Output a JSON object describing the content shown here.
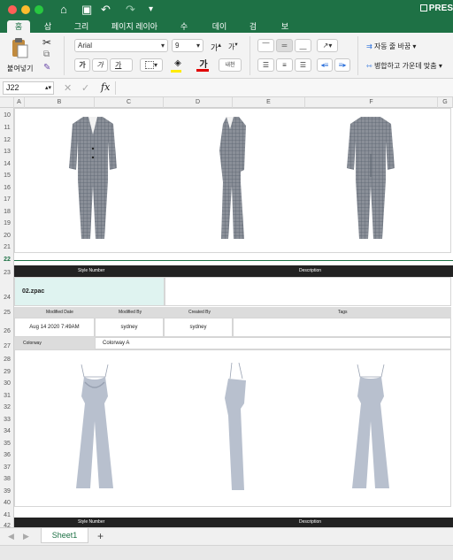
{
  "app": {
    "title_partial": "PRES"
  },
  "quick_access": {
    "home": "⌂",
    "save": "▣",
    "undo": "↶",
    "redo": "↷",
    "more": "▾"
  },
  "tabs": [
    "홈",
    "삽입",
    "그리기",
    "페이지 레이아웃",
    "수식",
    "데이터",
    "검토",
    "보기"
  ],
  "ribbon": {
    "paste": "붙여넣기",
    "font_name": "Arial",
    "font_size": "9",
    "grow": "가",
    "shrink": "가",
    "bold": "가",
    "italic": "가",
    "underline": "가",
    "font_color_glyph": "가",
    "phonetic": "내천",
    "wrap_text": "자동 줄 바꿈",
    "merge_center": "병합하고 가운데 맞춤"
  },
  "formula_bar": {
    "name_box": "J22",
    "cancel": "✕",
    "enter": "✓",
    "fx": "fx",
    "value": ""
  },
  "columns": [
    "A",
    "B",
    "C",
    "D",
    "E",
    "F",
    "G"
  ],
  "rows": [
    "10",
    "11",
    "12",
    "13",
    "14",
    "15",
    "16",
    "17",
    "18",
    "19",
    "20",
    "21",
    "22",
    "23",
    "24",
    "25",
    "26",
    "27",
    "28",
    "29",
    "30",
    "31",
    "32",
    "33",
    "34",
    "35",
    "36",
    "37",
    "38",
    "39",
    "40",
    "41",
    "42"
  ],
  "sheet": {
    "header_style_number": "Style Number",
    "header_description": "Description",
    "style_value": "02.zpac",
    "meta_headers": [
      "Modified Date",
      "Modified By",
      "Created By",
      "Tags"
    ],
    "meta_values": [
      "Aug 14 2020  7:49AM",
      "sydney",
      "sydney",
      ""
    ],
    "colorway_label": "Colorway",
    "colorway_value": "Colorway A",
    "bottom_style_number": "Style Number",
    "bottom_description": "Description"
  },
  "sheet_tabs": {
    "active": "Sheet1",
    "add": "+"
  },
  "colors": {
    "excel_green": "#1e7145",
    "band": "#222222",
    "style_cell": "#dff3f0",
    "meta_header": "#dcdcdc"
  }
}
